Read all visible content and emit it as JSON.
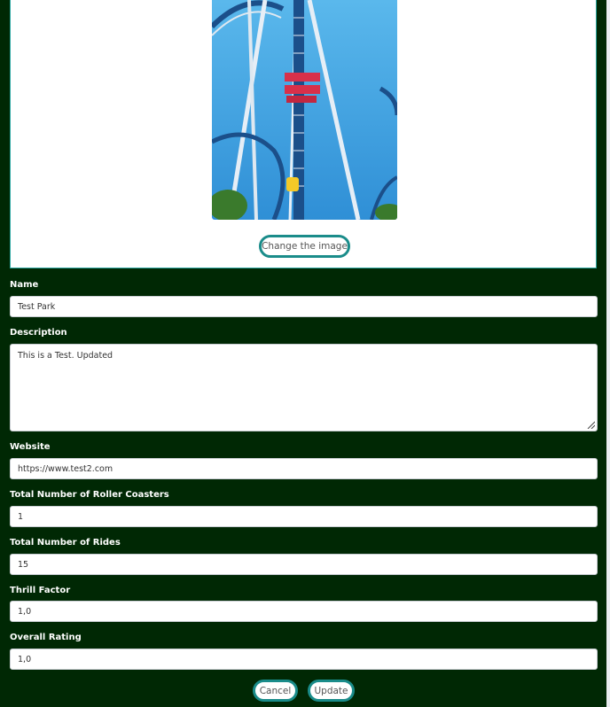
{
  "image_panel": {
    "change_image_label": "Change the image"
  },
  "form": {
    "name": {
      "label": "Name",
      "value": "Test Park"
    },
    "description": {
      "label": "Description",
      "value": "This is a Test. Updated"
    },
    "website": {
      "label": "Website",
      "value": "https://www.test2.com"
    },
    "roller_coasters": {
      "label": "Total Number of Roller Coasters",
      "value": "1"
    },
    "rides": {
      "label": "Total Number of Rides",
      "value": "15"
    },
    "thrill_factor": {
      "label": "Thrill Factor",
      "value": "1,0"
    },
    "overall_rating": {
      "label": "Overall Rating",
      "value": "1,0"
    }
  },
  "actions": {
    "cancel_label": "Cancel",
    "update_label": "Update"
  },
  "colors": {
    "background": "#002804",
    "accent": "#1a8c8a"
  }
}
